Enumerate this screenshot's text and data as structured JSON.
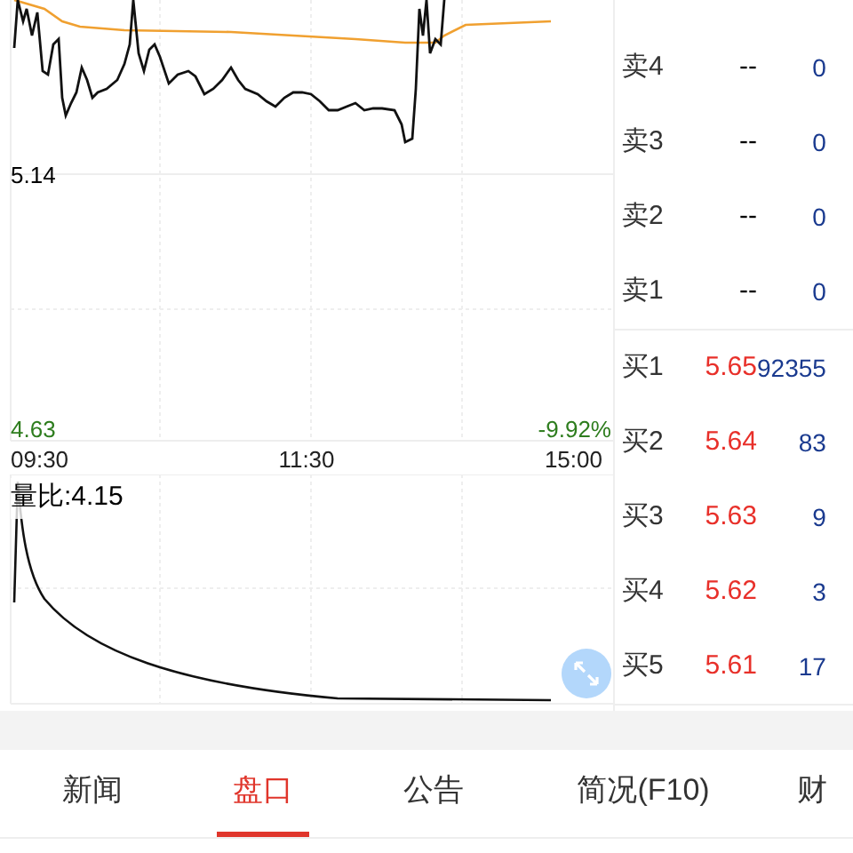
{
  "price_chart": {
    "price_label": "5.14",
    "low_label": "4.63",
    "change_label": "-9.92%",
    "time_labels": [
      "09:30",
      "11:30",
      "15:00"
    ]
  },
  "volume_ratio_chart": {
    "label": "量比:4.15"
  },
  "order_book": {
    "asks": [
      {
        "label": "卖4",
        "price": "--",
        "volume": "0"
      },
      {
        "label": "卖3",
        "price": "--",
        "volume": "0"
      },
      {
        "label": "卖2",
        "price": "--",
        "volume": "0"
      },
      {
        "label": "卖1",
        "price": "--",
        "volume": "0"
      }
    ],
    "bids": [
      {
        "label": "买1",
        "price": "5.65",
        "volume": "92355"
      },
      {
        "label": "买2",
        "price": "5.64",
        "volume": "83"
      },
      {
        "label": "买3",
        "price": "5.63",
        "volume": "9"
      },
      {
        "label": "买4",
        "price": "5.62",
        "volume": "3"
      },
      {
        "label": "买5",
        "price": "5.61",
        "volume": "17"
      }
    ]
  },
  "tabs": [
    {
      "label": "新闻",
      "selected": false
    },
    {
      "label": "盘口",
      "selected": true
    },
    {
      "label": "公告",
      "selected": false
    },
    {
      "label": "简况(F10)",
      "selected": false
    },
    {
      "label": "财",
      "selected": false
    }
  ]
}
